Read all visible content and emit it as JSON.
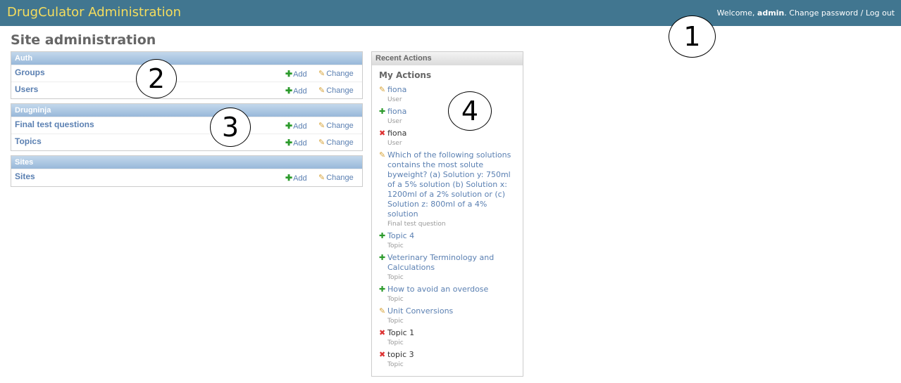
{
  "header": {
    "branding": "DrugCulator Administration",
    "welcome_text": "Welcome, ",
    "username": "admin",
    "period": ".",
    "change_password": "Change password",
    "separator": " / ",
    "logout": "Log out"
  },
  "page_title": "Site administration",
  "modules": [
    {
      "caption": "Auth",
      "models": [
        {
          "name": "Groups",
          "add": "Add",
          "change": "Change"
        },
        {
          "name": "Users",
          "add": "Add",
          "change": "Change"
        }
      ]
    },
    {
      "caption": "Drugninja",
      "models": [
        {
          "name": "Final test questions",
          "add": "Add",
          "change": "Change"
        },
        {
          "name": "Topics",
          "add": "Add",
          "change": "Change"
        }
      ]
    },
    {
      "caption": "Sites",
      "models": [
        {
          "name": "Sites",
          "add": "Add",
          "change": "Change"
        }
      ]
    }
  ],
  "recent_actions": {
    "caption": "Recent Actions",
    "title": "My Actions",
    "items": [
      {
        "icon": "pencil-icon",
        "label": "fiona",
        "type": "User"
      },
      {
        "icon": "plus-icon",
        "label": "fiona",
        "type": "User"
      },
      {
        "icon": "x-icon",
        "label": "fiona",
        "type": "User"
      },
      {
        "icon": "pencil-icon",
        "label": "Which of the following solutions contains the most solute byweight? (a) Solution y: 750ml of a 5% solution (b) Solution x: 1200ml of a 2% solution or (c) Solution z: 800ml of a 4% solution",
        "type": "Final test question"
      },
      {
        "icon": "plus-icon",
        "label": "Topic 4",
        "type": "Topic"
      },
      {
        "icon": "plus-icon",
        "label": "Veterinary Terminology and Calculations",
        "type": "Topic"
      },
      {
        "icon": "plus-icon",
        "label": "How to avoid an overdose",
        "type": "Topic"
      },
      {
        "icon": "pencil-icon",
        "label": "Unit Conversions",
        "type": "Topic"
      },
      {
        "icon": "x-icon",
        "label": "Topic 1",
        "type": "Topic"
      },
      {
        "icon": "x-icon",
        "label": "topic 3",
        "type": "Topic"
      }
    ]
  },
  "annotations": [
    "1",
    "2",
    "3",
    "4"
  ],
  "colors": {
    "header_bg": "#417690",
    "branding": "#f5dd5d",
    "link": "#5b80b2"
  }
}
